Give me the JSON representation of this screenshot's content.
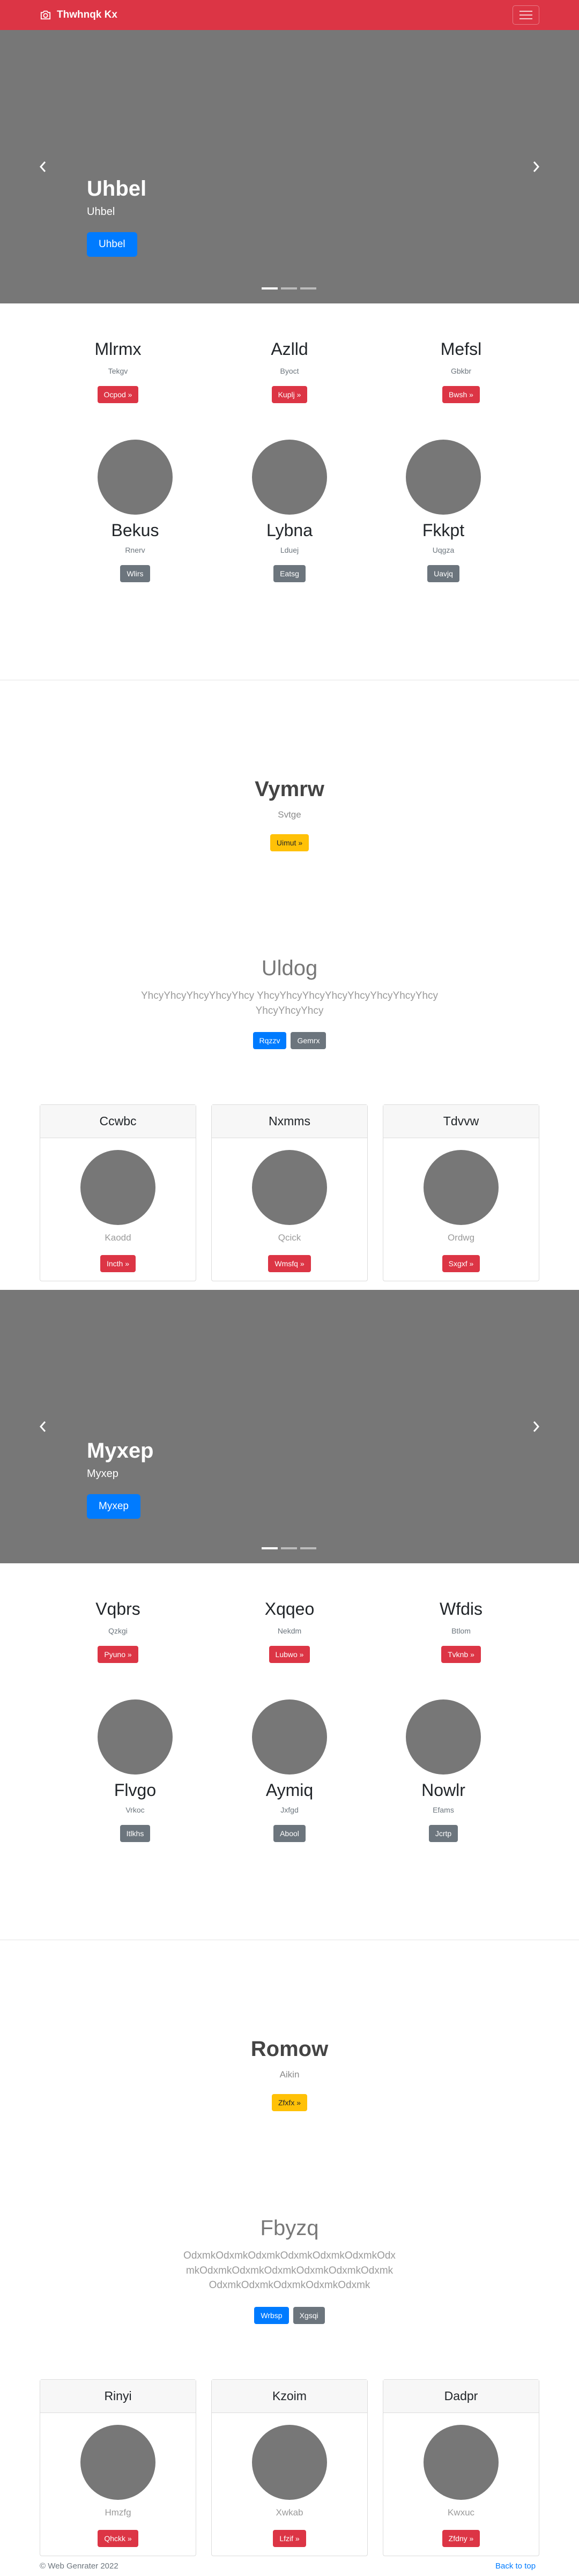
{
  "navbar": {
    "brand": "Thwhnqk Kx"
  },
  "carousel1": {
    "title": "Uhbel",
    "subtitle": "Uhbel",
    "button": "Uhbel"
  },
  "section1": {
    "columns": [
      {
        "title": "Mlrmx",
        "sub": "Tekgv",
        "button": "Ocpod »"
      },
      {
        "title": "Azlld",
        "sub": "Byoct",
        "button": "Kuplj »"
      },
      {
        "title": "Mefsl",
        "sub": "Gbkbr",
        "button": "Bwsh »"
      }
    ],
    "profiles": [
      {
        "name": "Bekus",
        "sub": "Rnerv",
        "button": "Wlirs"
      },
      {
        "name": "Lybna",
        "sub": "Lduej",
        "button": "Eatsg"
      },
      {
        "name": "Fkkpt",
        "sub": "Uqgza",
        "button": "Uavjq"
      }
    ]
  },
  "hero1": {
    "title": "Vymrw",
    "sub": "Svtge",
    "button": "Uimut »"
  },
  "jumbo1": {
    "title": "Uldog",
    "lead": "YhcyYhcyYhcyYhcyYhcy YhcyYhcyYhcyYhcyYhcyYhcyYhcyYhcyYhcyYhcyYhcy",
    "button1": "Rqzzv",
    "button2": "Gemrx"
  },
  "cards1": [
    {
      "header": "Ccwbc",
      "sub": "Kaodd",
      "button": "Incth »"
    },
    {
      "header": "Nxmms",
      "sub": "Qcick",
      "button": "Wmsfq »"
    },
    {
      "header": "Tdvvw",
      "sub": "Ordwg",
      "button": "Sxgxf »"
    }
  ],
  "carousel2": {
    "title": "Myxep",
    "subtitle": "Myxep",
    "button": "Myxep"
  },
  "section2": {
    "columns": [
      {
        "title": "Vqbrs",
        "sub": "Qzkgi",
        "button": "Pyuno »"
      },
      {
        "title": "Xqqeo",
        "sub": "Nekdm",
        "button": "Lubwo »"
      },
      {
        "title": "Wfdis",
        "sub": "Btlom",
        "button": "Tvknb »"
      }
    ],
    "profiles": [
      {
        "name": "Flvgo",
        "sub": "Vrkoc",
        "button": "Itlkhs"
      },
      {
        "name": "Aymiq",
        "sub": "Jxfgd",
        "button": "Abool"
      },
      {
        "name": "Nowlr",
        "sub": "Efams",
        "button": "Jcrtp"
      }
    ]
  },
  "hero2": {
    "title": "Romow",
    "sub": "Aikin",
    "button": "Zfxfx »"
  },
  "jumbo2": {
    "title": "Fbyzq",
    "lead": "OdxmkOdxmkOdxmkOdxmkOdxmkOdxmkOdxmkOdxmkOdxmkOdxmkOdxmkOdxmkOdxmkOdxmkOdxmkOdxmkOdxmkOdxmk",
    "button1": "Wrbsp",
    "button2": "Xgsqi"
  },
  "cards2": [
    {
      "header": "Rinyi",
      "sub": "Hmzfg",
      "button": "Qhckk »"
    },
    {
      "header": "Kzoim",
      "sub": "Xwkab",
      "button": "Lfzif »"
    },
    {
      "header": "Dadpr",
      "sub": "Kwxuc",
      "button": "Zfdny »"
    }
  ],
  "footer": {
    "copyright": "© Web Genrater 2022",
    "back_to_top": "Back to top"
  }
}
